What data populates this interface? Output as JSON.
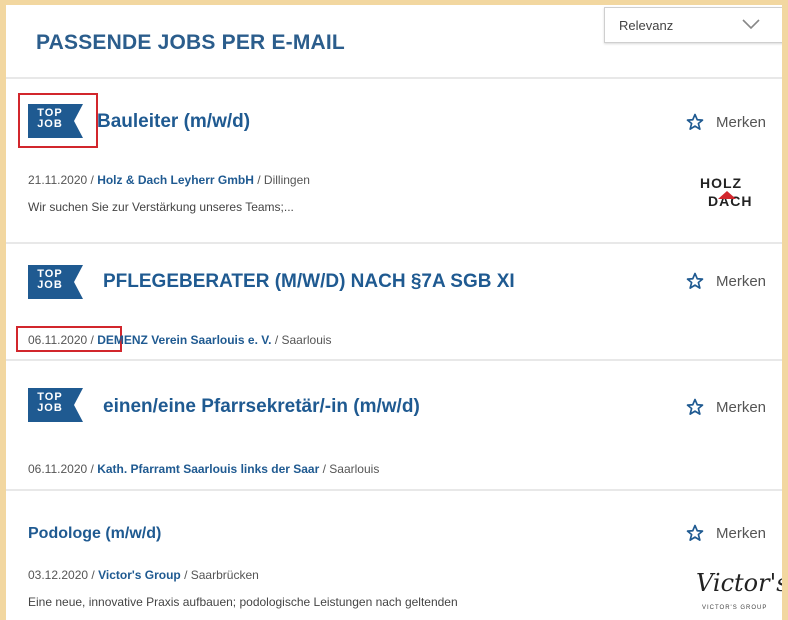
{
  "header": {
    "title": "PASSENDE JOBS PER E-MAIL"
  },
  "sort": {
    "selected": "Relevanz"
  },
  "badge": {
    "line1": "TOP",
    "line2": "JOB"
  },
  "jobs": [
    {
      "title": "Bauleiter (m/w/d)",
      "date": "21.11.2020",
      "company": "Holz & Dach Leyherr GmbH",
      "location": "Dillingen",
      "description": "Wir suchen Sie zur Verstärkung unseres Teams;...",
      "save_label": "Merken",
      "logo": {
        "line1": "HOLZ",
        "line2": "DACH"
      }
    },
    {
      "title": "PFLEGEBERATER (M/W/D) NACH §7A SGB XI",
      "date": "06.11.2020",
      "company": "DEMENZ Verein Saarlouis e. V.",
      "location": "Saarlouis",
      "save_label": "Merken"
    },
    {
      "title": "einen/eine Pfarrsekretär/-in (m/w/d)",
      "date": "06.11.2020",
      "company": "Kath. Pfarramt Saarlouis links der Saar",
      "location": "Saarlouis",
      "save_label": "Merken"
    },
    {
      "title": "Podologe (m/w/d)",
      "date": "03.12.2020",
      "company": "Victor's Group",
      "location": "Saarbrücken",
      "description": "Eine neue, innovative Praxis aufbauen; podologische Leistungen nach geltenden",
      "save_label": "Merken",
      "logo": {
        "line1": "Victor's",
        "line2": "VICTOR'S GROUP"
      }
    }
  ],
  "separator": " / ",
  "colors": {
    "accent": "#1f5a91",
    "badge": "#1f5a91",
    "highlight_frame": "#d2262c",
    "page_bg": "#f2d7a0"
  },
  "icons": {
    "save": "star-outline-icon",
    "sort": "chevron-down-icon"
  }
}
